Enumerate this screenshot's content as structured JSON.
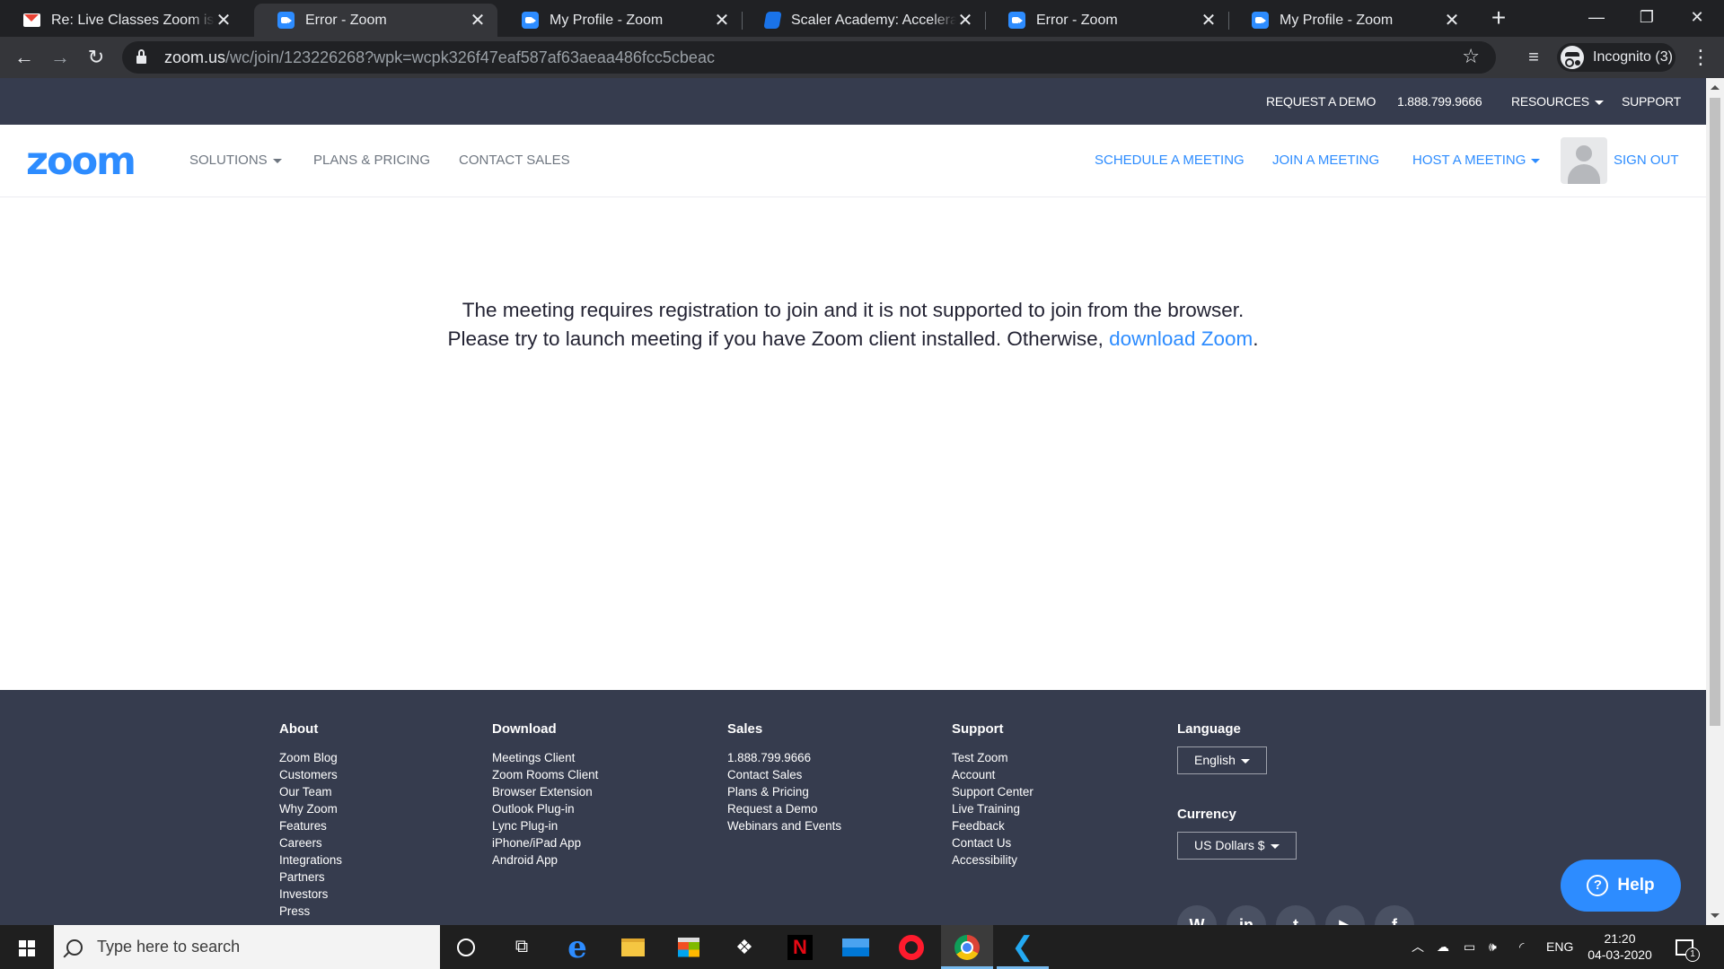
{
  "browser": {
    "tabs": [
      {
        "title": "Re: Live Classes Zoom issue -",
        "icon": "gmail-icon"
      },
      {
        "title": "Error - Zoom",
        "icon": "zoom-icon"
      },
      {
        "title": "My Profile - Zoom",
        "icon": "zoom-icon"
      },
      {
        "title": "Scaler Academy: Accelerate y",
        "icon": "scaler-icon"
      },
      {
        "title": "Error - Zoom",
        "icon": "zoom-icon"
      },
      {
        "title": "My Profile - Zoom",
        "icon": "zoom-icon"
      }
    ],
    "active_tab": 1,
    "url_host": "zoom.us",
    "url_path": "/wc/join/123226268?wpk=wcpk326f47eaf587af63aeaa486fcc5cbeac",
    "incognito_label": "Incognito (3)"
  },
  "topbar": {
    "request_demo": "REQUEST A DEMO",
    "phone": "1.888.799.9666",
    "resources": "RESOURCES",
    "support": "SUPPORT"
  },
  "nav": {
    "logo": "zoom",
    "solutions": "SOLUTIONS",
    "plans_pricing": "PLANS & PRICING",
    "contact_sales": "CONTACT SALES",
    "schedule": "SCHEDULE A MEETING",
    "join": "JOIN A MEETING",
    "host": "HOST A MEETING",
    "sign_out": "SIGN OUT"
  },
  "message": {
    "line1": "The meeting requires registration to join and it is not supported to join from the browser.",
    "line2_prefix": "Please try to launch meeting if you have Zoom client installed. Otherwise, ",
    "line2_link": "download Zoom",
    "line2_suffix": "."
  },
  "footer": {
    "about": {
      "heading": "About",
      "links": [
        "Zoom Blog",
        "Customers",
        "Our Team",
        "Why Zoom",
        "Features",
        "Careers",
        "Integrations",
        "Partners",
        "Investors",
        "Press"
      ]
    },
    "download": {
      "heading": "Download",
      "links": [
        "Meetings Client",
        "Zoom Rooms Client",
        "Browser Extension",
        "Outlook Plug-in",
        "Lync Plug-in",
        "iPhone/iPad App",
        "Android App"
      ]
    },
    "sales": {
      "heading": "Sales",
      "links": [
        "1.888.799.9666",
        "Contact Sales",
        "Plans & Pricing",
        "Request a Demo",
        "Webinars and Events"
      ]
    },
    "support": {
      "heading": "Support",
      "links": [
        "Test Zoom",
        "Account",
        "Support Center",
        "Live Training",
        "Feedback",
        "Contact Us",
        "Accessibility"
      ]
    },
    "language": {
      "heading": "Language",
      "value": "English"
    },
    "currency": {
      "heading": "Currency",
      "value": "US Dollars $"
    },
    "social_icons": [
      "wordpress-icon",
      "linkedin-icon",
      "twitter-icon",
      "youtube-icon",
      "facebook-icon"
    ]
  },
  "help_button": "Help",
  "taskbar": {
    "search_placeholder": "Type here to search",
    "language": "ENG",
    "time": "21:20",
    "date": "04-03-2020",
    "notification_count": "1"
  },
  "colors": {
    "zoom_blue": "#2d8cff",
    "zoom_dark": "#363c4e",
    "chrome_dark": "#202124",
    "chrome_toolbar": "#35363a"
  }
}
